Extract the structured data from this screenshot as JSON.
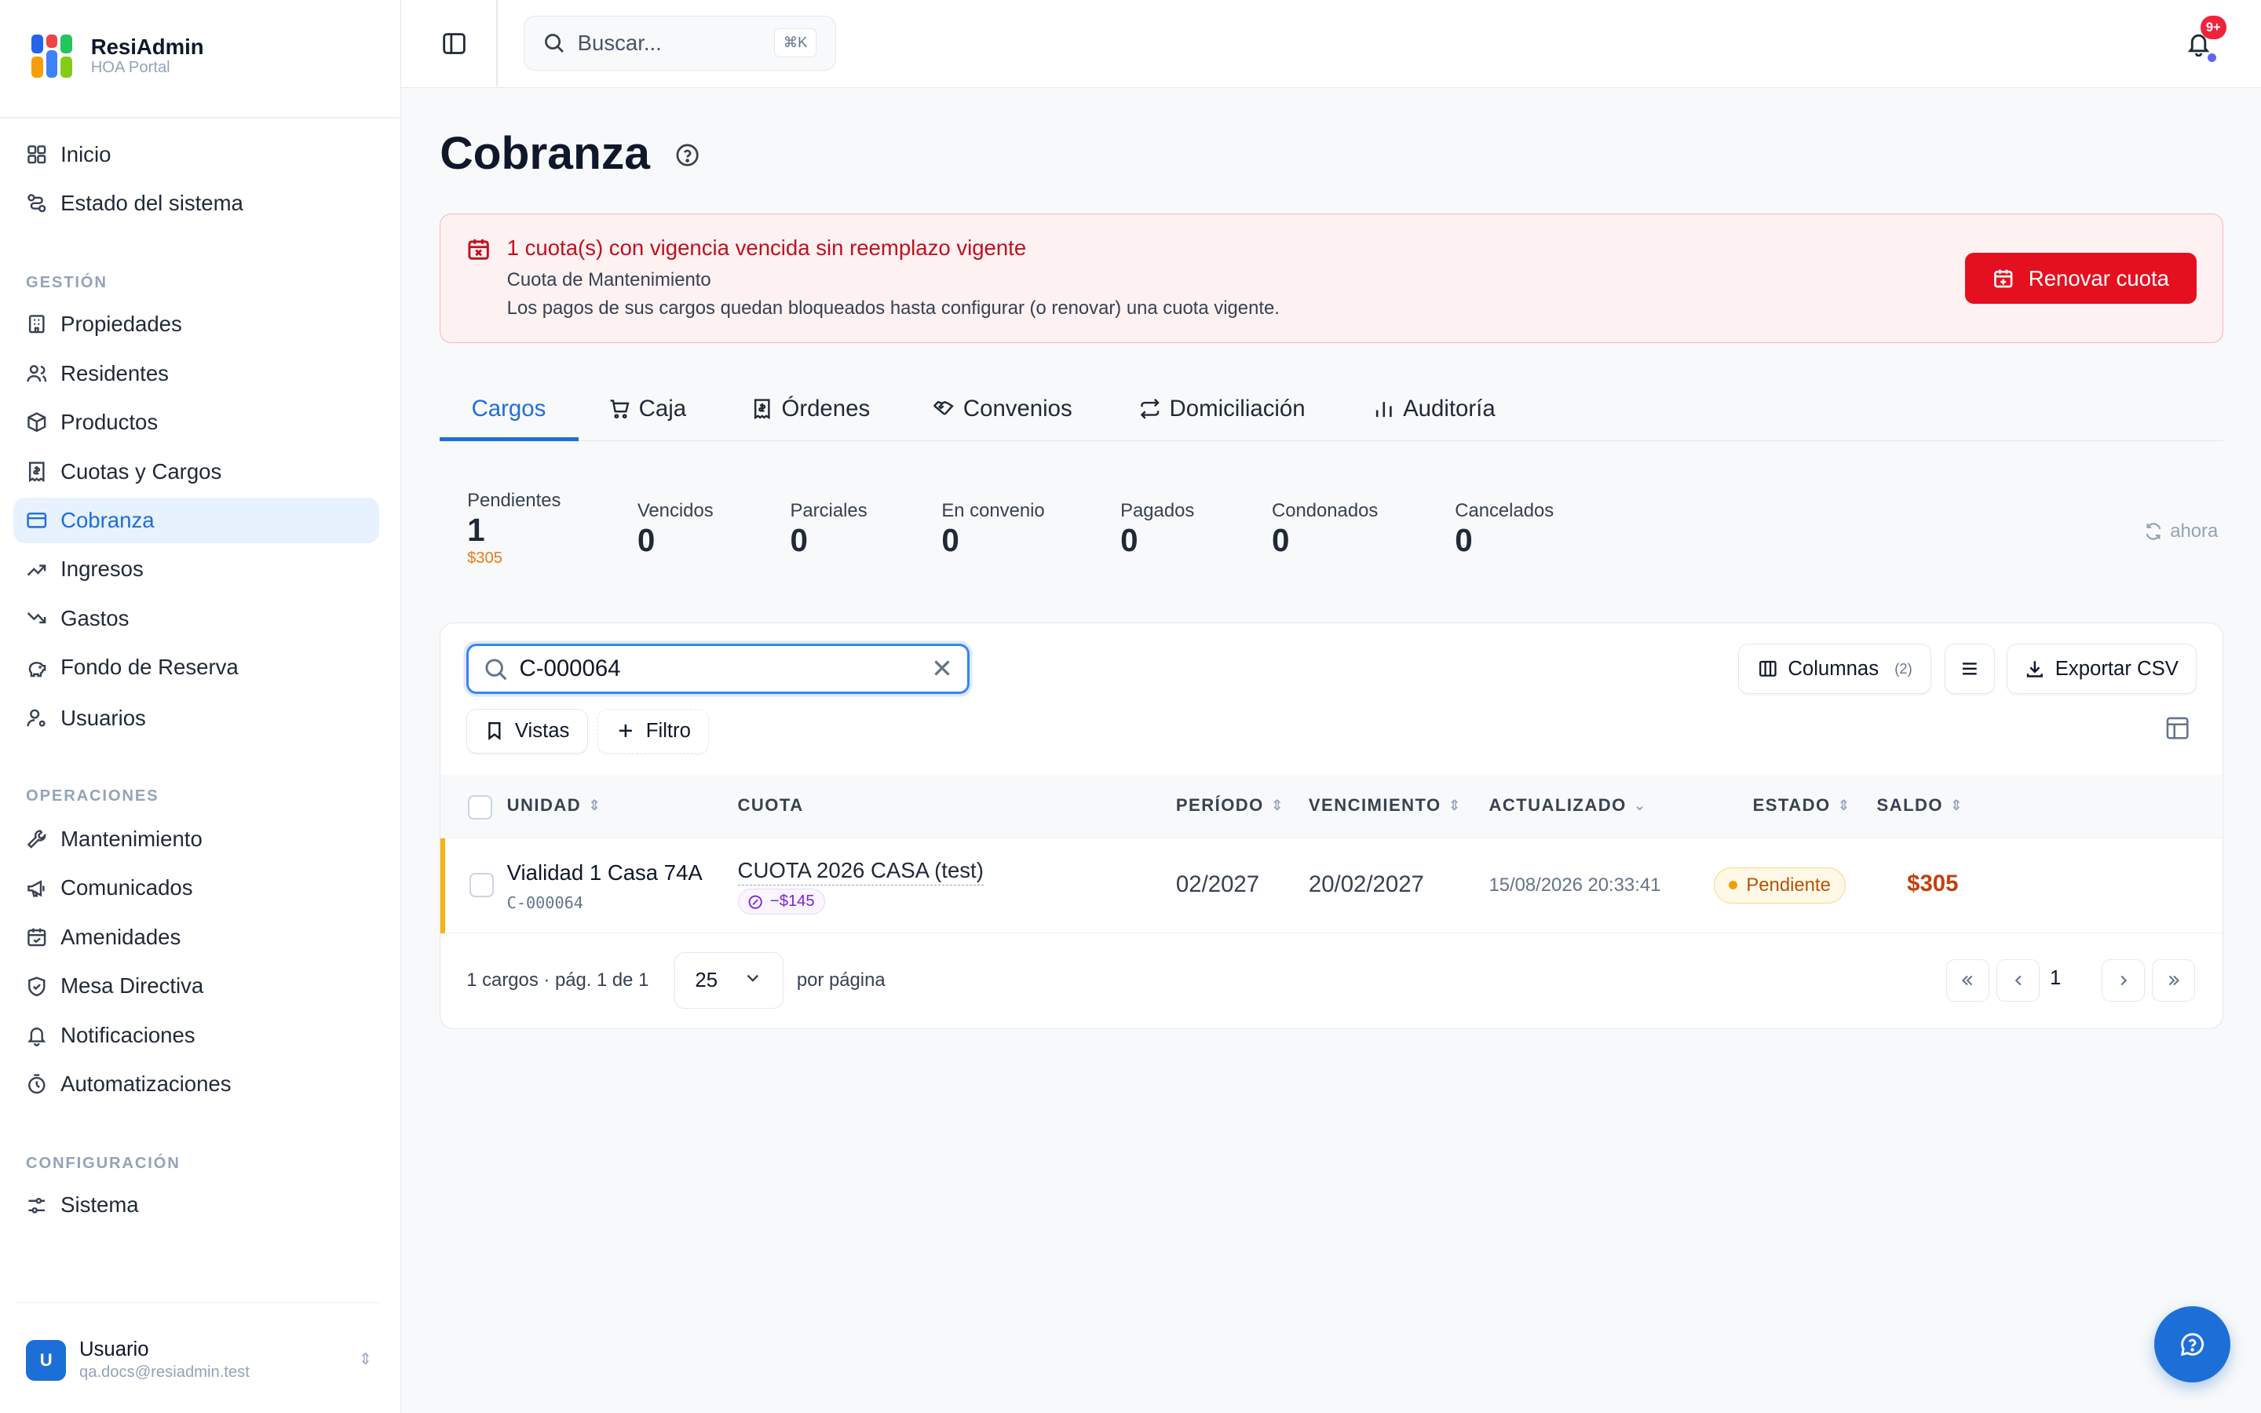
{
  "app": {
    "name": "ResiAdmin",
    "subtitle": "HOA Portal"
  },
  "sidebar": {
    "top_items": [
      {
        "label": "Inicio",
        "icon": "dashboard-grid-icon"
      },
      {
        "label": "Estado del sistema",
        "icon": "route-icon"
      }
    ],
    "sections": [
      {
        "label": "GESTIÓN",
        "items": [
          {
            "label": "Propiedades",
            "icon": "building-icon"
          },
          {
            "label": "Residentes",
            "icon": "users-icon"
          },
          {
            "label": "Productos",
            "icon": "package-icon"
          },
          {
            "label": "Cuotas y Cargos",
            "icon": "receipt-icon"
          },
          {
            "label": "Cobranza",
            "icon": "credit-card-icon",
            "active": true
          },
          {
            "label": "Ingresos",
            "icon": "trending-up-icon"
          },
          {
            "label": "Gastos",
            "icon": "trending-down-icon"
          },
          {
            "label": "Fondo de Reserva",
            "icon": "piggy-bank-icon"
          },
          {
            "label": "Usuarios",
            "icon": "user-cog-icon"
          }
        ]
      },
      {
        "label": "OPERACIONES",
        "items": [
          {
            "label": "Mantenimiento",
            "icon": "wrench-icon"
          },
          {
            "label": "Comunicados",
            "icon": "megaphone-icon"
          },
          {
            "label": "Amenidades",
            "icon": "calendar-check-icon"
          },
          {
            "label": "Mesa Directiva",
            "icon": "shield-icon"
          },
          {
            "label": "Notificaciones",
            "icon": "bell-icon"
          },
          {
            "label": "Automatizaciones",
            "icon": "timer-icon"
          }
        ]
      },
      {
        "label": "CONFIGURACIÓN",
        "items": [
          {
            "label": "Sistema",
            "icon": "sliders-icon"
          }
        ]
      }
    ],
    "user": {
      "initial": "U",
      "name": "Usuario",
      "email": "qa.docs@resiadmin.test"
    }
  },
  "topbar": {
    "search_placeholder": "Buscar...",
    "shortcut": "⌘K",
    "notifications_badge": "9+"
  },
  "page": {
    "title": "Cobranza"
  },
  "alert": {
    "title": "1 cuota(s) con vigencia vencida sin reemplazo vigente",
    "line1": "Cuota de Mantenimiento",
    "line2": "Los pagos de sus cargos quedan bloqueados hasta configurar (o renovar) una cuota vigente.",
    "button": "Renovar cuota"
  },
  "tabs": [
    {
      "label": "Cargos",
      "active": true
    },
    {
      "label": "Caja",
      "icon": "cart-icon"
    },
    {
      "label": "Órdenes",
      "icon": "receipt-icon"
    },
    {
      "label": "Convenios",
      "icon": "handshake-icon"
    },
    {
      "label": "Domiciliación",
      "icon": "repeat-icon"
    },
    {
      "label": "Auditoría",
      "icon": "bar-chart-icon"
    }
  ],
  "stats": [
    {
      "label": "Pendientes",
      "value": "1",
      "amount": "$305"
    },
    {
      "label": "Vencidos",
      "value": "0"
    },
    {
      "label": "Parciales",
      "value": "0"
    },
    {
      "label": "En convenio",
      "value": "0"
    },
    {
      "label": "Pagados",
      "value": "0"
    },
    {
      "label": "Condonados",
      "value": "0"
    },
    {
      "label": "Cancelados",
      "value": "0"
    }
  ],
  "refresh_label": "ahora",
  "toolbar": {
    "search_value": "C-000064",
    "columns_label": "Columnas",
    "columns_count": "(2)",
    "export_label": "Exportar CSV",
    "views_label": "Vistas",
    "filter_label": "Filtro"
  },
  "table": {
    "headers": [
      "UNIDAD",
      "CUOTA",
      "PERÍODO",
      "VENCIMIENTO",
      "ACTUALIZADO",
      "ESTADO",
      "SALDO"
    ],
    "rows": [
      {
        "unit": "Vialidad 1 Casa 74A",
        "code": "C-000064",
        "quota": "CUOTA 2026 CASA (test)",
        "discount": "−$145",
        "period": "02/2027",
        "due": "20/02/2027",
        "updated": "15/08/2026 20:33:41",
        "status": "Pendiente",
        "balance": "$305"
      }
    ]
  },
  "pagination": {
    "summary": "1 cargos · pág. 1 de 1",
    "per_page": "25",
    "per_page_label": "por página",
    "current_page": "1"
  },
  "colors": {
    "accent": "#1d6fd8",
    "danger": "#e5101f",
    "warning": "#f5b21a",
    "balance": "#c2410c"
  }
}
